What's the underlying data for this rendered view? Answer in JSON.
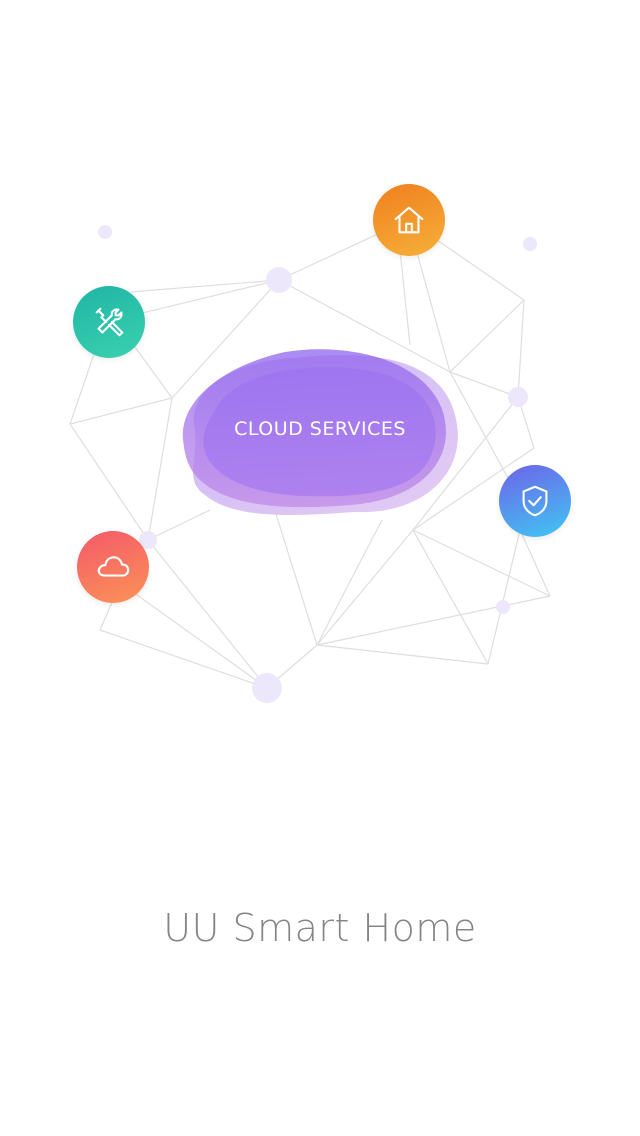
{
  "center": {
    "label": "CLOUD SERVICES"
  },
  "icons": {
    "home": "home-icon",
    "tools": "tools-icon",
    "security": "shield-check-icon",
    "cloud": "cloud-icon"
  },
  "colors": {
    "blob": "#9b6ae8",
    "home": "#f39a2a",
    "tools": "#2ac3ab",
    "security": "#5b8ff0",
    "cloud": "#f7705f",
    "title": "#858585"
  },
  "app": {
    "title": "UU Smart Home"
  }
}
